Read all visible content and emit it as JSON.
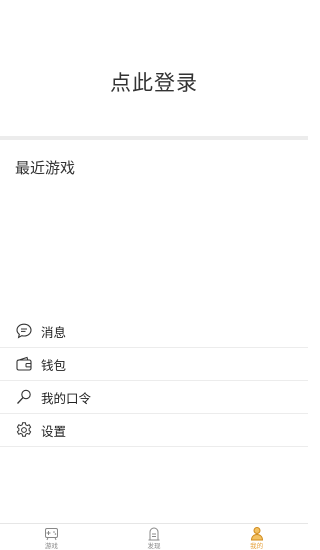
{
  "header": {
    "login_label": "点此登录"
  },
  "recent": {
    "title": "最近游戏"
  },
  "menu": {
    "items": [
      {
        "label": "消息",
        "icon": "chat-bubble-icon"
      },
      {
        "label": "钱包",
        "icon": "wallet-icon"
      },
      {
        "label": "我的口令",
        "icon": "magnifier-key-icon"
      },
      {
        "label": "设置",
        "icon": "gear-icon"
      }
    ]
  },
  "tabbar": {
    "tabs": [
      {
        "label": "游戏",
        "icon": "gamepad-icon",
        "active": false
      },
      {
        "label": "发现",
        "icon": "discover-icon",
        "active": false
      },
      {
        "label": "我的",
        "icon": "person-icon",
        "active": true
      }
    ],
    "active_color": "#e6a23c",
    "inactive_color": "#888888"
  }
}
